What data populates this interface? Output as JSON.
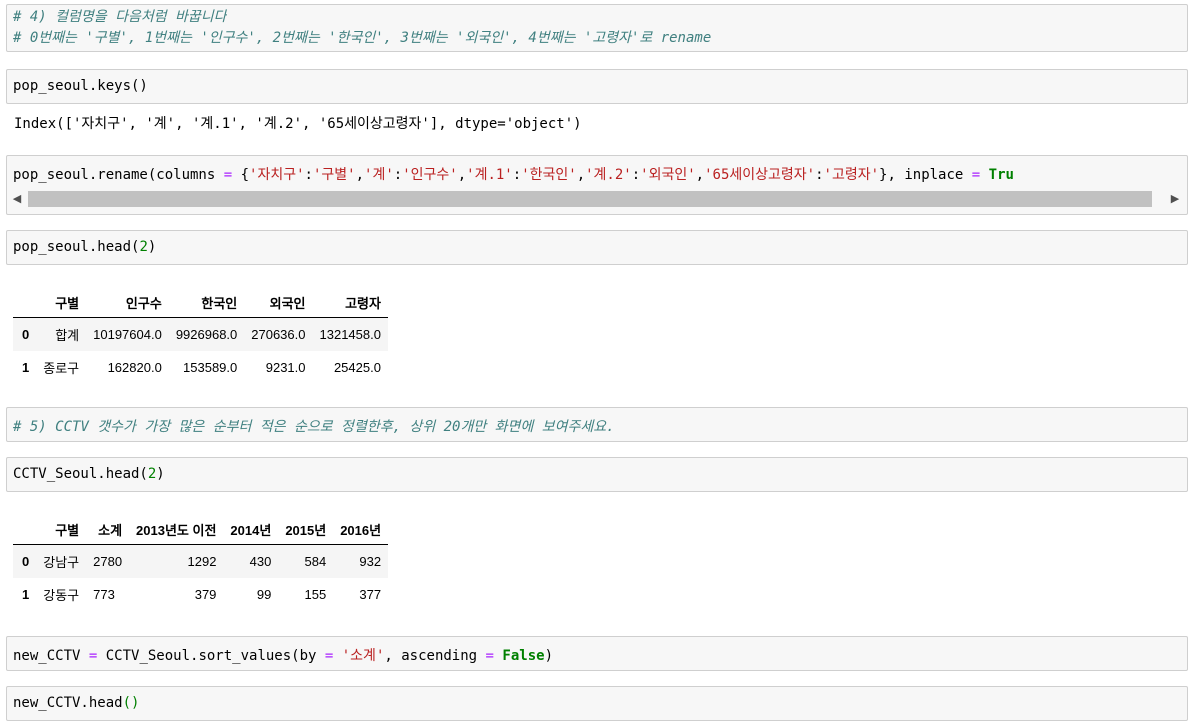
{
  "cells": {
    "c1": {
      "line1": "# 4) 컬럼명을 다음처럼 바꿉니다",
      "line2": "# 0번째는 '구별', 1번째는 '인구수', 2번째는 '한국인', 3번째는 '외국인', 4번째는 '고령자'로 rename"
    },
    "c2": {
      "code": "pop_seoul.keys()"
    },
    "c2_out": "Index(['자치구', '계', '계.1', '계.2', '65세이상고령자'], dtype='object')",
    "c3": {
      "p1": "pop_seoul.rename(columns ",
      "eq1": "=",
      "p2": " {",
      "s1": "'자치구'",
      "c1": ":",
      "s2": "'구별'",
      "c2": ",",
      "s3": "'계'",
      "c3": ":",
      "s4": "'인구수'",
      "c4": ",",
      "s5": "'계.1'",
      "c5": ":",
      "s6": "'한국인'",
      "c6": ",",
      "s7": "'계.2'",
      "c7": ":",
      "s8": "'외국인'",
      "c8": ",",
      "s9": "'65세이상고령자'",
      "c9": ":",
      "s10": "'고령자'",
      "p3": "}, inplace ",
      "eq2": "=",
      "p4": " ",
      "kw": "Tru"
    },
    "c4": {
      "pre": "pop_seoul.head(",
      "num": "2",
      "post": ")"
    },
    "table1": {
      "headers": [
        "",
        "구별",
        "인구수",
        "한국인",
        "외국인",
        "고령자"
      ],
      "rows": [
        [
          "0",
          "합계",
          "10197604.0",
          "9926968.0",
          "270636.0",
          "1321458.0"
        ],
        [
          "1",
          "종로구",
          "162820.0",
          "153589.0",
          "9231.0",
          "25425.0"
        ]
      ]
    },
    "c5": {
      "line": "# 5) CCTV 갯수가 가장 많은 순부터 적은 순으로 정렬한후, 상위 20개만 화면에 보여주세요."
    },
    "c6": {
      "pre": "CCTV_Seoul.head(",
      "num": "2",
      "post": ")"
    },
    "table2": {
      "headers": [
        "",
        "구별",
        "소계",
        "2013년도 이전",
        "2014년",
        "2015년",
        "2016년"
      ],
      "rows": [
        [
          "0",
          "강남구",
          "2780",
          "1292",
          "430",
          "584",
          "932"
        ],
        [
          "1",
          "강동구",
          "773",
          "379",
          "99",
          "155",
          "377"
        ]
      ]
    },
    "c7": {
      "p1": "new_CCTV ",
      "eq1": "=",
      "p2": " CCTV_Seoul.sort_values(by ",
      "eq2": "=",
      "p3": " ",
      "str": "'소계'",
      "p4": ", ascending ",
      "eq3": "=",
      "p5": " ",
      "kw": "False",
      "p6": ")"
    },
    "c8": {
      "pre": "new_CCTV.head",
      "paren": "()"
    }
  },
  "colors": {
    "comment": "#408080",
    "string": "#ba2121",
    "number": "#008000",
    "operator": "#aa22ff",
    "cell_bg": "#f7f7f7"
  }
}
